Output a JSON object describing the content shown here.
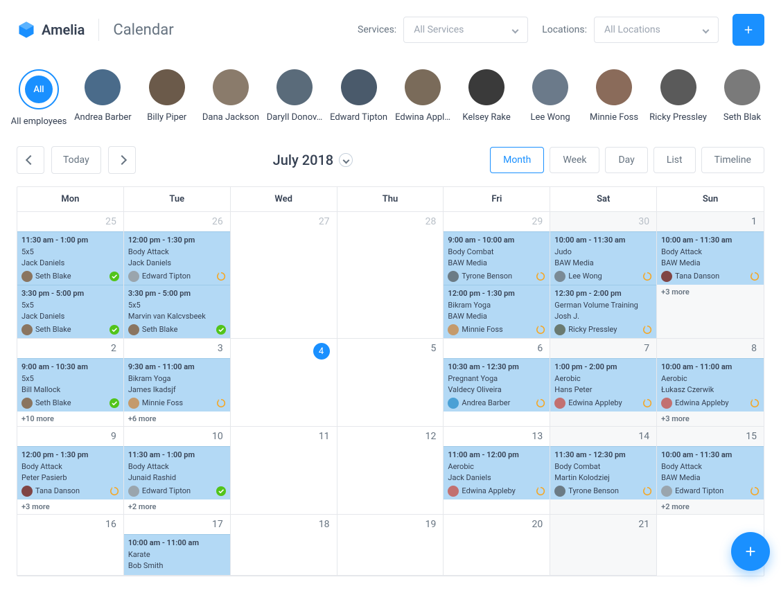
{
  "brand": "Amelia",
  "page_title": "Calendar",
  "filters": {
    "services_label": "Services:",
    "services_value": "All Services",
    "locations_label": "Locations:",
    "locations_value": "All Locations"
  },
  "employees": [
    {
      "name": "All employees",
      "all": true,
      "pill": "All"
    },
    {
      "name": "Andrea Barber"
    },
    {
      "name": "Billy Piper"
    },
    {
      "name": "Dana Jackson"
    },
    {
      "name": "Daryll Donov…"
    },
    {
      "name": "Edward Tipton"
    },
    {
      "name": "Edwina Appl…"
    },
    {
      "name": "Kelsey Rake"
    },
    {
      "name": "Lee Wong"
    },
    {
      "name": "Minnie Foss"
    },
    {
      "name": "Ricky Pressley"
    },
    {
      "name": "Seth Blak"
    }
  ],
  "toolbar": {
    "today": "Today",
    "month_label": "July 2018",
    "views": [
      "Month",
      "Week",
      "Day",
      "List",
      "Timeline"
    ],
    "active_view": "Month"
  },
  "weekdays": [
    "Mon",
    "Tue",
    "Wed",
    "Thu",
    "Fri",
    "Sat",
    "Sun"
  ],
  "avatar_colors": {
    "seth": "#8a7560",
    "edward": "#9aa5ad",
    "minnie": "#c49a6c",
    "tyrone": "#6b7b85",
    "lee": "#7a8a95",
    "tana": "#804545",
    "ricky": "#6a7a70",
    "andrea": "#4aa0d5",
    "edwina": "#c27070"
  },
  "cells": [
    {
      "num": "25",
      "grey": true,
      "events": [
        {
          "time": "11:30 am - 1:00 pm",
          "title": "5x5",
          "sub": "Jack Daniels",
          "person": "Seth Blake",
          "avk": "seth",
          "status": "approved"
        },
        {
          "time": "3:30 pm - 5:00 pm",
          "title": "5x5",
          "sub": "Jack Daniels",
          "person": "Seth Blake",
          "avk": "seth",
          "status": "approved"
        }
      ]
    },
    {
      "num": "26",
      "grey": true,
      "events": [
        {
          "time": "12:00 pm - 1:30 pm",
          "title": "Body Attack",
          "sub": "Jack Daniels",
          "person": "Edward Tipton",
          "avk": "edward",
          "status": "pending"
        },
        {
          "time": "3:30 pm - 5:00 pm",
          "title": "5x5",
          "sub": "Marvin van Kalcvsbeek",
          "person": "Seth Blake",
          "avk": "seth",
          "status": "approved"
        }
      ]
    },
    {
      "num": "27",
      "grey": true
    },
    {
      "num": "28",
      "grey": true
    },
    {
      "num": "29",
      "grey": true,
      "events": [
        {
          "time": "9:00 am - 10:00 am",
          "title": "Body Combat",
          "sub": "BAW Media",
          "person": "Tyrone Benson",
          "avk": "tyrone",
          "status": "pending"
        },
        {
          "time": "12:00 pm - 1:30 pm",
          "title": "Bikram Yoga",
          "sub": "BAW Media",
          "person": "Minnie Foss",
          "avk": "minnie",
          "status": "pending"
        }
      ]
    },
    {
      "num": "30",
      "grey": true,
      "shade": true,
      "events": [
        {
          "time": "10:00 am - 11:30 am",
          "title": "Judo",
          "sub": "BAW Media",
          "person": "Lee Wong",
          "avk": "lee",
          "status": "pending"
        },
        {
          "time": "12:30 pm - 2:00 pm",
          "title": "German Volume Training",
          "sub": "Josh J.",
          "person": "Ricky Pressley",
          "avk": "ricky",
          "status": "pending"
        }
      ]
    },
    {
      "num": "1",
      "shade": true,
      "events": [
        {
          "time": "10:00 am - 11:30 am",
          "title": "Body Attack",
          "sub": "BAW Media",
          "person": "Tana Danson",
          "avk": "tana",
          "status": "pending"
        }
      ],
      "more": "+3 more"
    },
    {
      "num": "2",
      "events": [
        {
          "time": "9:00 am - 10:30 am",
          "title": "5x5",
          "sub": "Bill Mallock",
          "person": "Seth Blake",
          "avk": "seth",
          "status": "approved"
        }
      ],
      "more": "+10 more"
    },
    {
      "num": "3",
      "events": [
        {
          "time": "9:30 am - 11:00 am",
          "title": "Bikram Yoga",
          "sub": "James Ikadsjf",
          "person": "Minnie Foss",
          "avk": "minnie",
          "status": "pending"
        }
      ],
      "more": "+6 more"
    },
    {
      "num": "4",
      "today": true
    },
    {
      "num": "5"
    },
    {
      "num": "6",
      "events": [
        {
          "time": "10:30 am - 12:30 pm",
          "title": "Pregnant Yoga",
          "sub": "Valdecy Oliveira",
          "person": "Andrea Barber",
          "avk": "andrea",
          "status": "pending"
        }
      ]
    },
    {
      "num": "7",
      "shade": true,
      "events": [
        {
          "time": "1:00 pm - 2:00 pm",
          "title": "Aerobic",
          "sub": "Hans Peter",
          "person": "Edwina Appleby",
          "avk": "edwina",
          "status": "pending"
        }
      ]
    },
    {
      "num": "8",
      "shade": true,
      "events": [
        {
          "time": "10:00 am - 11:00 am",
          "title": "Aerobic",
          "sub": "Łukasz Czerwik",
          "person": "Edwina Appleby",
          "avk": "edwina",
          "status": "pending"
        }
      ],
      "more": "+3 more"
    },
    {
      "num": "9",
      "events": [
        {
          "time": "12:00 pm - 1:30 pm",
          "title": "Body Attack",
          "sub": "Peter Pasierb",
          "person": "Tana Danson",
          "avk": "tana",
          "status": "pending"
        }
      ],
      "more": "+3 more"
    },
    {
      "num": "10",
      "events": [
        {
          "time": "11:30 am - 1:00 pm",
          "title": "Body Attack",
          "sub": "Junaid Rashid",
          "person": "Edward Tipton",
          "avk": "edward",
          "status": "approved"
        }
      ],
      "more": "+2 more"
    },
    {
      "num": "11"
    },
    {
      "num": "12"
    },
    {
      "num": "13",
      "events": [
        {
          "time": "11:00 am - 12:00 pm",
          "title": "Aerobic",
          "sub": "Jack Daniels",
          "person": "Edwina Appleby",
          "avk": "edwina",
          "status": "pending"
        }
      ]
    },
    {
      "num": "14",
      "shade": true,
      "events": [
        {
          "time": "11:30 am - 12:30 pm",
          "title": "Body Combat",
          "sub": "Martin Kolodziej",
          "person": "Tyrone Benson",
          "avk": "tyrone",
          "status": "pending"
        }
      ]
    },
    {
      "num": "15",
      "shade": true,
      "events": [
        {
          "time": "10:00 am - 11:30 am",
          "title": "Body Attack",
          "sub": "BAW Media",
          "person": "Edward Tipton",
          "avk": "edward",
          "status": "pending"
        }
      ],
      "more": "+2 more"
    },
    {
      "num": "16"
    },
    {
      "num": "17",
      "events": [
        {
          "time": "10:00 am - 11:00 am",
          "title": "Karate",
          "sub": "Bob Smith"
        }
      ]
    },
    {
      "num": "18"
    },
    {
      "num": "19"
    },
    {
      "num": "20"
    },
    {
      "num": "21",
      "shade": true
    }
  ]
}
